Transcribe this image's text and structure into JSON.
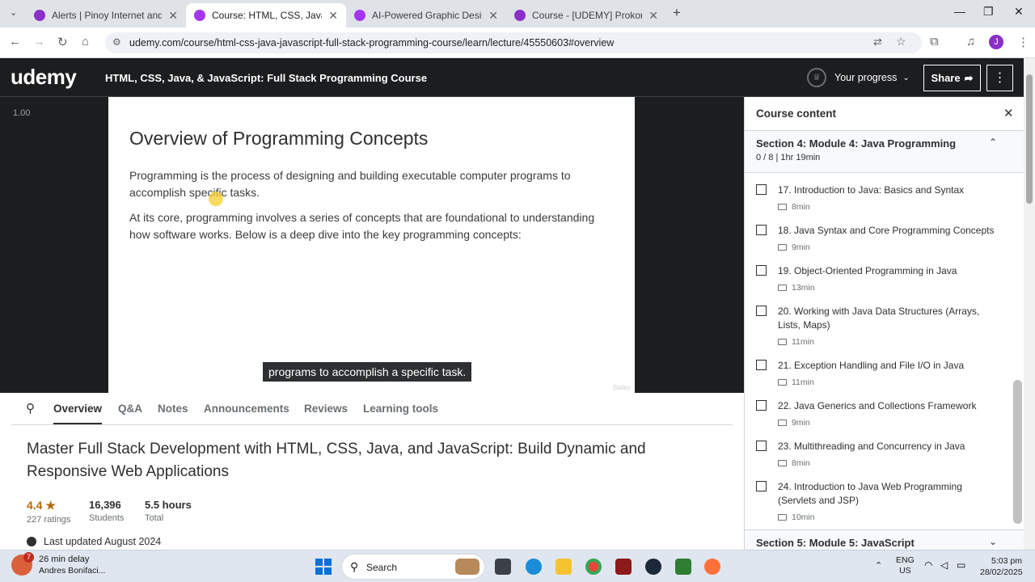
{
  "browser": {
    "tabs": [
      {
        "title": "Alerts | Pinoy Internet and Tech",
        "close": "✕"
      },
      {
        "title": "Course: HTML, CSS, Java, & JavaScript",
        "close": "✕"
      },
      {
        "title": "AI-Powered Graphic Design: Master",
        "close": "✕"
      },
      {
        "title": "Course - [UDEMY] Prokon Civil",
        "close": "✕"
      }
    ],
    "new_tab": "+",
    "url": "udemy.com/course/html-css-java-javascript-full-stack-programming-course/learn/lecture/45550603#overview",
    "profile_initial": "J"
  },
  "header": {
    "logo": "udemy",
    "course_title": "HTML, CSS, Java, & JavaScript: Full Stack Programming Course",
    "progress_label": "Your progress",
    "share_label": "Share",
    "more_label": "⋮"
  },
  "video": {
    "speed": "1.00",
    "slide_title": "Overview of Programming Concepts",
    "paragraph1": "Programming is the process of designing and building executable computer programs to accomplish specific tasks.",
    "paragraph2": "At its core, programming involves a series of concepts that are foundational to understanding how software works. Below is a deep dive into the key programming concepts:",
    "caption": "programs to accomplish a specific task.",
    "watermark": "Bailey"
  },
  "lower": {
    "tabs": [
      "Overview",
      "Q&A",
      "Notes",
      "Announcements",
      "Reviews",
      "Learning tools"
    ],
    "heading": "Master Full Stack Development with HTML, CSS, Java, and JavaScript: Build Dynamic and Responsive Web Applications",
    "rating": "4.4 ★",
    "ratings_count": "227 ratings",
    "students": "16,396",
    "students_label": "Students",
    "hours": "5.5 hours",
    "hours_label": "Total",
    "updated": "Last updated August 2024"
  },
  "sidebar": {
    "title": "Course content",
    "section4": {
      "title": "Section 4: Module 4: Java Programming",
      "sub": "0 / 8 | 1hr 19min"
    },
    "lectures": [
      {
        "title": "17. Introduction to Java: Basics and Syntax",
        "duration": "8min"
      },
      {
        "title": "18. Java Syntax and Core Programming Concepts",
        "duration": "9min"
      },
      {
        "title": "19. Object-Oriented Programming in Java",
        "duration": "13min"
      },
      {
        "title": "20. Working with Java Data Structures (Arrays, Lists, Maps)",
        "duration": "11min"
      },
      {
        "title": "21. Exception Handling and File I/O in Java",
        "duration": "11min"
      },
      {
        "title": "22. Java Generics and Collections Framework",
        "duration": "9min"
      },
      {
        "title": "23. Multithreading and Concurrency in Java",
        "duration": "8min"
      },
      {
        "title": "24. Introduction to Java Web Programming (Servlets and JSP)",
        "duration": "10min"
      }
    ],
    "section5": {
      "title": "Section 5: Module 5: JavaScript"
    }
  },
  "taskbar": {
    "weather_badge": "7",
    "weather_line1": "26 min delay",
    "weather_line2": "Andres Bonifaci...",
    "search": "Search",
    "lang1": "ENG",
    "lang2": "US",
    "time": "5:03 pm",
    "date": "28/02/2025"
  },
  "colors": {
    "udemy_dark": "#1c1d1f",
    "accent_purple": "#a435f0",
    "rating": "#b4690e"
  }
}
